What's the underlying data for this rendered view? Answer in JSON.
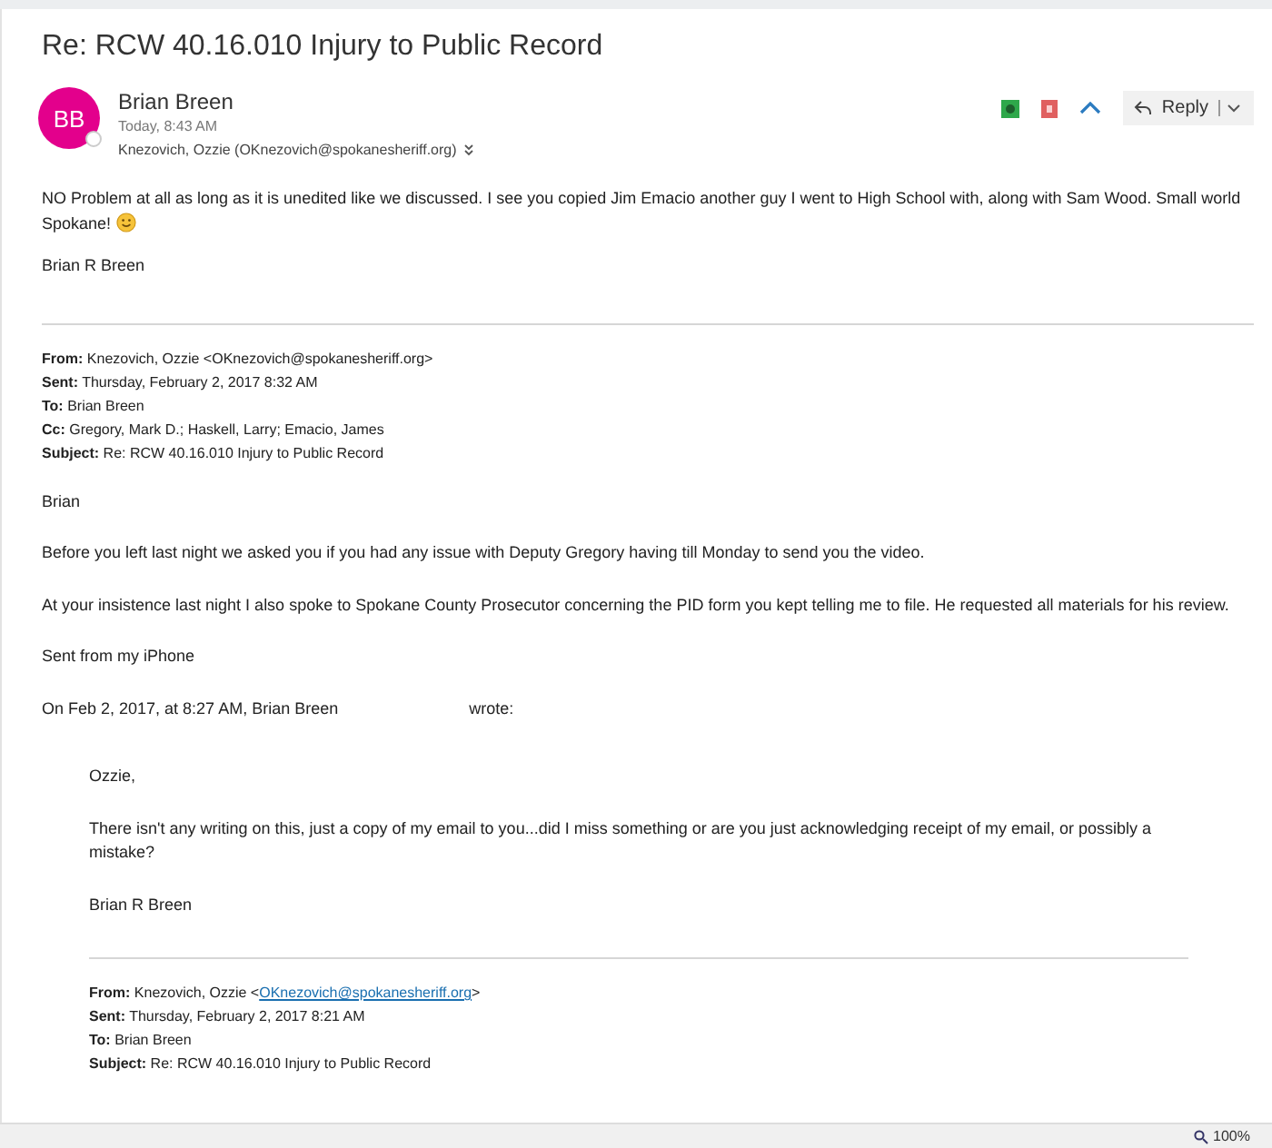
{
  "subject": "Re: RCW 40.16.010 Injury to Public Record",
  "sender": {
    "initials": "BB",
    "name": "Brian Breen",
    "time": "Today, 8:43 AM",
    "recipients": "Knezovich, Ozzie (OKnezovich@spokanesheriff.org)"
  },
  "reply_button": {
    "label": "Reply"
  },
  "message": {
    "paragraphs": [
      "NO Problem at all as long as it is unedited like we discussed. I see you copied Jim Emacio another guy I went to High School with, along with Sam Wood. Small world Spokane!"
    ],
    "signature": "Brian R Breen"
  },
  "quoted_1": {
    "headers": [
      {
        "label": "From:",
        "value": "Knezovich, Ozzie <OKnezovich@spokanesheriff.org>"
      },
      {
        "label": "Sent:",
        "value": "Thursday, February 2, 2017 8:32 AM"
      },
      {
        "label": "To:",
        "value": "Brian Breen"
      },
      {
        "label": "Cc:",
        "value": "Gregory, Mark D.; Haskell, Larry; Emacio, James"
      },
      {
        "label": "Subject:",
        "value": "Re: RCW 40.16.010 Injury to Public Record"
      }
    ],
    "paragraphs": [
      "Brian",
      "Before you left last night we asked you if you had any issue with Deputy Gregory having till Monday to send you the video.",
      "At your insistence last night I also spoke to Spokane County Prosecutor concerning the PID form you kept telling me to file.  He requested all materials for his review.",
      "Sent from my iPhone"
    ],
    "attribution": {
      "before": "On Feb 2, 2017, at 8:27 AM, Brian Breen",
      "after": "wrote:"
    }
  },
  "quoted_2": {
    "paragraphs": [
      "Ozzie,",
      "There isn't any writing on this, just a copy of my email to you...did I miss something or are you just acknowledging receipt of my email, or possibly a mistake?",
      "Brian R Breen"
    ],
    "headers": [
      {
        "label": "From:",
        "value": "Knezovich, Ozzie <",
        "link": "OKnezovich@spokanesheriff.org",
        "suffix": ">"
      },
      {
        "label": "Sent:",
        "value": "Thursday, February 2, 2017 8:21 AM"
      },
      {
        "label": "To:",
        "value": "Brian Breen"
      },
      {
        "label": "Subject:",
        "value": "Re: RCW 40.16.010 Injury to Public Record"
      }
    ]
  },
  "status_bar": {
    "zoom": "100%"
  }
}
